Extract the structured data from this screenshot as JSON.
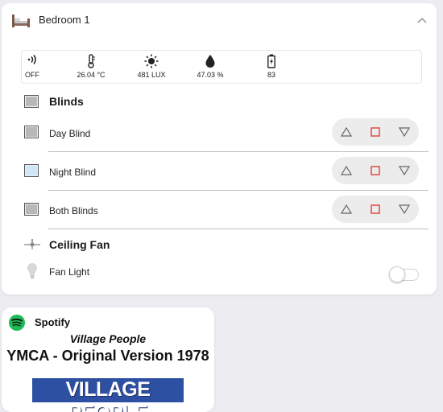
{
  "room": {
    "title": "Bedroom 1",
    "icon": "bed-icon",
    "collapse_icon": "chevron-up-icon"
  },
  "sensors": [
    {
      "icon": "signal-icon",
      "value": "OFF"
    },
    {
      "icon": "thermometer-icon",
      "value": "26.04 °C"
    },
    {
      "icon": "sun-icon",
      "value": "481 LUX"
    },
    {
      "icon": "water-drop-icon",
      "value": "47.03 %"
    },
    {
      "icon": "battery-charging-icon",
      "value": "83"
    }
  ],
  "blinds": {
    "title": "Blinds",
    "rows": [
      {
        "label": "Day Blind",
        "icon": "blind-closed-icon"
      },
      {
        "label": "Night Blind",
        "icon": "blind-open-icon"
      },
      {
        "label": "Both Blinds",
        "icon": "blind-closed-icon"
      }
    ],
    "controls": [
      "up-arrow-icon",
      "stop-icon",
      "down-arrow-icon"
    ]
  },
  "ceiling_fan": {
    "title": "Ceiling Fan",
    "icon": "ceiling-fan-icon",
    "light": {
      "label": "Fan Light",
      "icon": "lightbulb-icon",
      "state": "off"
    }
  },
  "spotify": {
    "title": "Spotify",
    "icon": "spotify-icon",
    "artist": "Village People",
    "track": "YMCA - Original Version 1978",
    "album_art_text": "VILLAGE PEOPLE"
  },
  "colors": {
    "background": "#ececf1",
    "card": "#ffffff",
    "stop_red": "#e0413a",
    "control_bg": "#ececec",
    "spotify_green": "#1db954",
    "album_blue": "#2d50a3"
  }
}
